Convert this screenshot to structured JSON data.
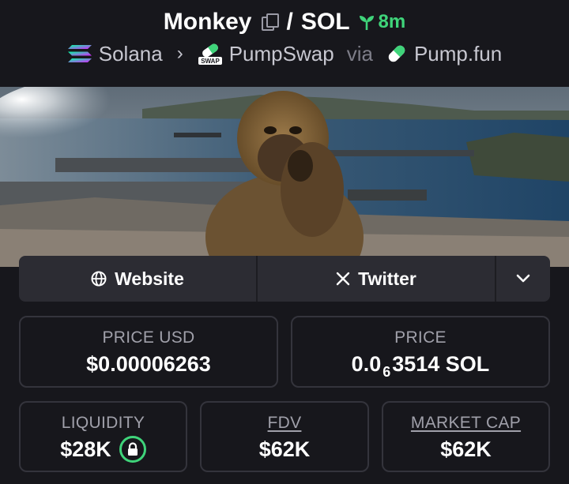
{
  "header": {
    "token_name": "Monkey",
    "separator": "/",
    "quote": "SOL",
    "age": "8m",
    "chain": "Solana",
    "dex": "PumpSwap",
    "dex_badge": "SWAP",
    "via": "via",
    "launchpad": "Pump.fun"
  },
  "links": {
    "website": "Website",
    "twitter": "Twitter"
  },
  "stats": {
    "price_usd_label": "PRICE USD",
    "price_usd": "$0.00006263",
    "price_label": "PRICE",
    "price_prefix": "0.0",
    "price_zeros": "6",
    "price_rest": "3514 SOL",
    "liquidity_label": "LIQUIDITY",
    "liquidity": "$28K",
    "fdv_label": "FDV",
    "fdv": "$62K",
    "mcap_label": "MARKET CAP",
    "mcap": "$62K"
  },
  "colors": {
    "background": "#17171c",
    "accent_green": "#3fd47a",
    "card_border": "#34343c",
    "link_bar": "#2c2c33"
  },
  "icons": [
    "copy-icon",
    "sprout-icon",
    "solana-icon",
    "pumpswap-icon",
    "pill-icon",
    "globe-icon",
    "x-icon",
    "chevron-down-icon",
    "lock-icon"
  ]
}
